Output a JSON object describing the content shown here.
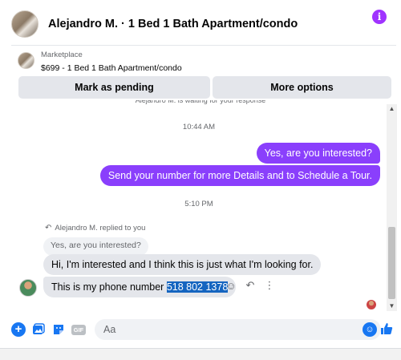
{
  "header": {
    "title": "Alejandro M. · 1 Bed 1 Bath Apartment/condo",
    "info_icon": "info-icon",
    "info_glyph": "i"
  },
  "listing": {
    "source": "Marketplace",
    "title": "$699 - 1 Bed 1 Bath Apartment/condo",
    "mark_pending_label": "Mark as pending",
    "more_options_label": "More options"
  },
  "chat": {
    "partial_notice": "Alejandro M. is waiting for your response",
    "timestamp_1": "10:44 AM",
    "timestamp_2": "5:10 PM",
    "outgoing": [
      "Yes, are you interested?",
      "Send your number for more Details and to Schedule a Tour."
    ],
    "replied_label": "Alejandro M. replied to you",
    "quoted_text": "Yes, are you interested?",
    "incoming_1": "Hi, I'm interested and I think this is just what I'm looking for.",
    "incoming_2_prefix": "This is my phone number ",
    "incoming_2_phone": "518 802 1378"
  },
  "composer": {
    "placeholder": "Aa"
  },
  "colors": {
    "accent_purple": "#8a3ffc",
    "messenger_blue": "#1877f2",
    "bubble_gray": "#e4e6eb",
    "selection_blue": "#1565c0"
  }
}
